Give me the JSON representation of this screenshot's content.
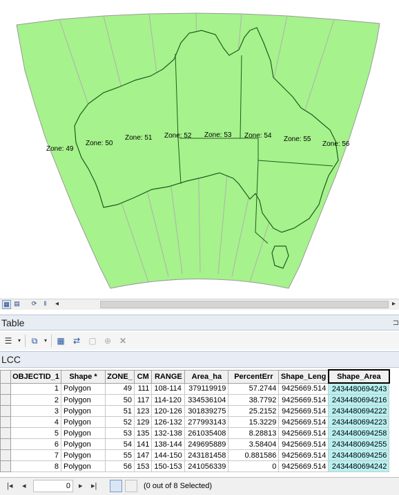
{
  "map": {
    "zone_labels": [
      "Zone: 49",
      "Zone: 50",
      "Zone: 51",
      "Zone: 52",
      "Zone: 53",
      "Zone: 54",
      "Zone: 55",
      "Zone: 56"
    ],
    "fill_color": "#a6f28c",
    "grid_color": "#b0b0b0",
    "coast_color": "#1f5a1f"
  },
  "panel": {
    "title": "Table",
    "tab_label": "LCC"
  },
  "table": {
    "columns": [
      "OBJECTID_1",
      "Shape *",
      "ZONE_",
      "CM",
      "RANGE",
      "Area_ha",
      "PercentErr",
      "Shape_Leng",
      "Shape_Area"
    ],
    "rows": [
      [
        "1",
        "Polygon",
        "49",
        "111",
        "108-114",
        "379119919",
        "57.2744",
        "9425669.514",
        "2434480694243"
      ],
      [
        "2",
        "Polygon",
        "50",
        "117",
        "114-120",
        "334536104",
        "38.7792",
        "9425669.514",
        "2434480694216"
      ],
      [
        "3",
        "Polygon",
        "51",
        "123",
        "120-126",
        "301839275",
        "25.2152",
        "9425669.514",
        "2434480694222"
      ],
      [
        "4",
        "Polygon",
        "52",
        "129",
        "126-132",
        "277993143",
        "15.3229",
        "9425669.514",
        "2434480694223"
      ],
      [
        "5",
        "Polygon",
        "53",
        "135",
        "132-138",
        "261035408",
        "8.28813",
        "9425669.514",
        "2434480694258"
      ],
      [
        "6",
        "Polygon",
        "54",
        "141",
        "138-144",
        "249695889",
        "3.58404",
        "9425669.514",
        "2434480694255"
      ],
      [
        "7",
        "Polygon",
        "55",
        "147",
        "144-150",
        "243181458",
        "0.881586",
        "9425669.514",
        "2434480694256"
      ],
      [
        "8",
        "Polygon",
        "56",
        "153",
        "150-153",
        "241056339",
        "0",
        "9425669.514",
        "2434480694242"
      ]
    ],
    "highlight_color": "#b8f0f0"
  },
  "status": {
    "record_value": "0",
    "selection_text": "(0 out of 8 Selected)"
  },
  "icons": [
    "table-view-icon",
    "layout-view-icon",
    "refresh-icon",
    "pause-icon",
    "table-options-icon",
    "related-tables-icon",
    "select-by-attributes-icon",
    "switch-selection-icon",
    "clear-selection-icon",
    "zoom-to-selected-icon",
    "delete-selected-icon",
    "first-record-icon",
    "previous-record-icon",
    "next-record-icon",
    "last-record-icon",
    "show-all-records-icon",
    "show-selected-records-icon"
  ]
}
